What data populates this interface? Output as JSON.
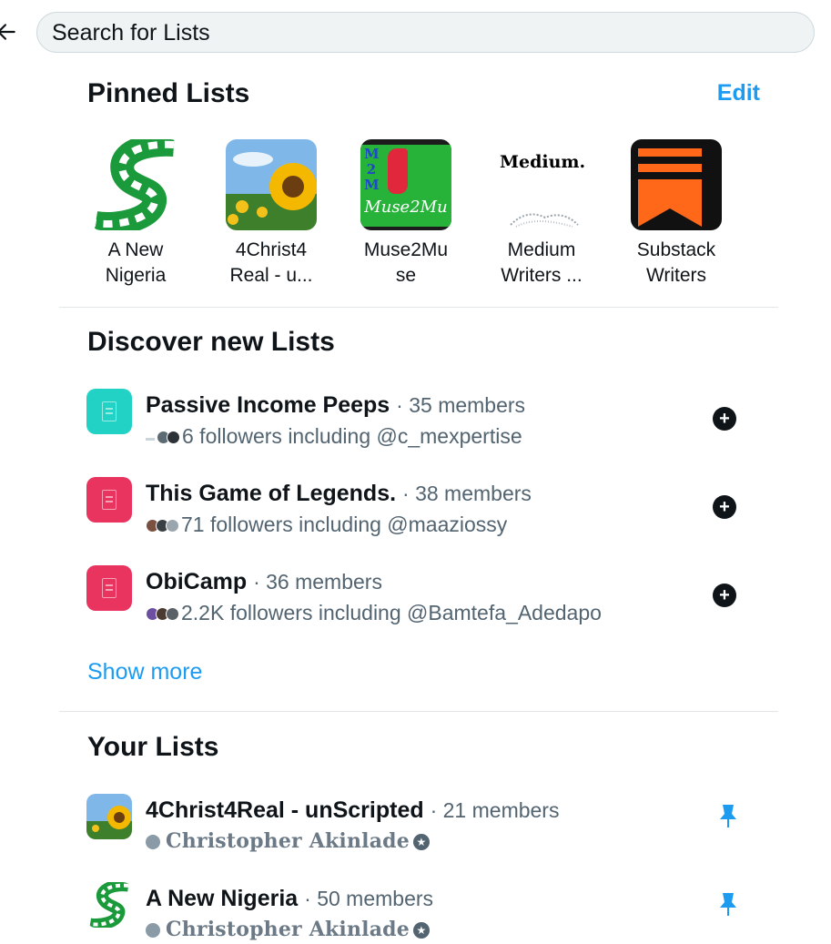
{
  "search": {
    "placeholder": "Search for Lists"
  },
  "pinned": {
    "title": "Pinned Lists",
    "edit_label": "Edit",
    "items": [
      {
        "line1": "A New",
        "line2": "Nigeria"
      },
      {
        "line1": "4Christ4",
        "line2": "Real - u..."
      },
      {
        "line1": "Muse2Mu",
        "line2": "se",
        "thumb_text": "Muse2Mu",
        "thumb_side": "M2M"
      },
      {
        "line1": "Medium",
        "line2": "Writers ...",
        "thumb_text": "Medium."
      },
      {
        "line1": "Substack",
        "line2": "Writers"
      }
    ]
  },
  "discover": {
    "title": "Discover new Lists",
    "items": [
      {
        "name": "Passive Income Peeps",
        "members": "· 35 members",
        "followers": "6 followers including @c_mexpertise",
        "icon_color": "#22d3c5"
      },
      {
        "name": "This Game of Legends.",
        "members": "· 38 members",
        "followers": "71 followers including @maaziossy",
        "icon_color": "#e8345e"
      },
      {
        "name": "ObiCamp",
        "members": "· 36 members",
        "followers": "2.2K followers including @Bamtefa_Adedapo",
        "icon_color": "#e8345e"
      }
    ],
    "show_more": "Show more"
  },
  "your_lists": {
    "title": "Your Lists",
    "items": [
      {
        "name": "4Christ4Real - unScripted",
        "members": "· 21 members",
        "owner": "Christopher Akinlade"
      },
      {
        "name": "A New Nigeria",
        "members": "· 50 members",
        "owner": "Christopher Akinlade"
      }
    ]
  },
  "colors": {
    "accent": "#1d9bf0",
    "text": "#0f1419",
    "secondary": "#536471"
  }
}
